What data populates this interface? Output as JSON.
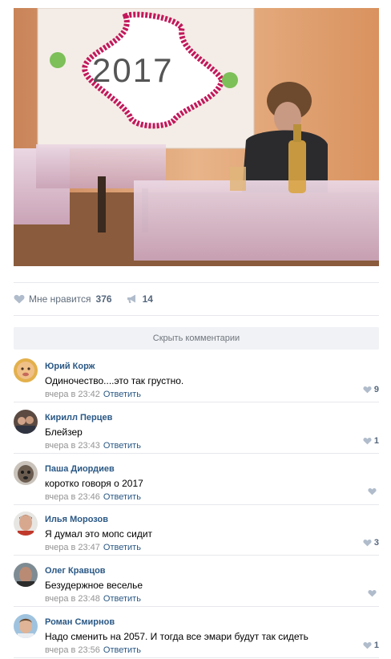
{
  "photo": {
    "decoration_text": "2017"
  },
  "post_actions": {
    "like_label": "Мне нравится",
    "like_count": "376",
    "share_count": "14"
  },
  "hide_comments_label": "Скрыть комментарии",
  "reply_label": "Ответить",
  "comments": [
    {
      "author": "Юрий Корж",
      "text": "Одиночество....это так грустно.",
      "date": "вчера в 23:42",
      "likes": "9"
    },
    {
      "author": "Кирилл Перцев",
      "text": "Блейзер",
      "date": "вчера в 23:43",
      "likes": "1"
    },
    {
      "author": "Паша Диордиев",
      "text": "коротко говоря о 2017",
      "date": "вчера в 23:46",
      "likes": ""
    },
    {
      "author": "Илья Морозов",
      "text": "Я думал это мопс сидит",
      "date": "вчера в 23:47",
      "likes": "3"
    },
    {
      "author": "Олег Кравцов",
      "text": "Безудержное веселье",
      "date": "вчера в 23:48",
      "likes": ""
    },
    {
      "author": "Роман Смирнов",
      "text": "Надо сменить на 2057. И тогда все эмари будут так сидеть",
      "date": "вчера в 23:56",
      "likes": "1"
    }
  ],
  "colors": {
    "link": "#2a5885",
    "icon": "#b0bccb",
    "muted": "#939393"
  },
  "icons": {
    "like": "heart-icon",
    "share": "megaphone-icon"
  }
}
